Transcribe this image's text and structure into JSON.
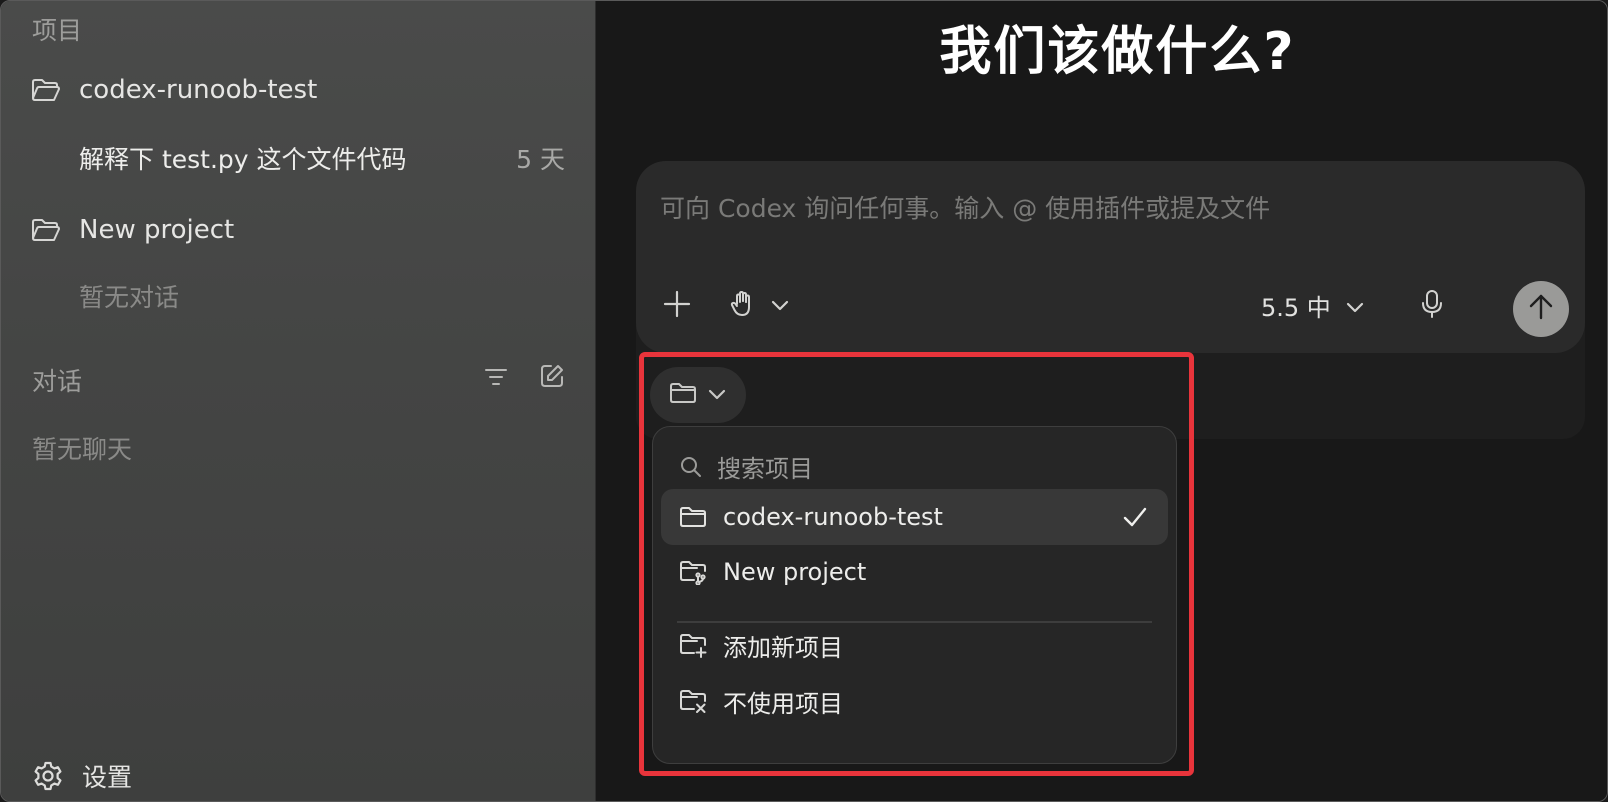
{
  "sidebar": {
    "projects_title": "项目",
    "projects": [
      {
        "name": "codex-runoob-test"
      },
      {
        "name": "New project"
      }
    ],
    "thread": {
      "title": "解释下 test.py 这个文件代码",
      "time": "5 天"
    },
    "empty_project_threads": "暂无对话",
    "conversations_title": "对话",
    "empty_chats": "暂无聊天",
    "settings_label": "设置"
  },
  "main": {
    "heading": "我们该做什么?",
    "composer": {
      "placeholder": "可向 Codex 询问任何事。输入 @ 使用插件或提及文件",
      "model_label": "5.5 中"
    },
    "project_dropdown": {
      "search_placeholder": "搜索项目",
      "items": [
        {
          "label": "codex-runoob-test",
          "selected": true
        },
        {
          "label": "New project",
          "selected": false
        }
      ],
      "actions": [
        {
          "label": "添加新项目"
        },
        {
          "label": "不使用项目"
        }
      ]
    }
  },
  "colors": {
    "highlight": "#e8343b",
    "sidebar_bg": "#444544",
    "main_bg": "#181818"
  }
}
